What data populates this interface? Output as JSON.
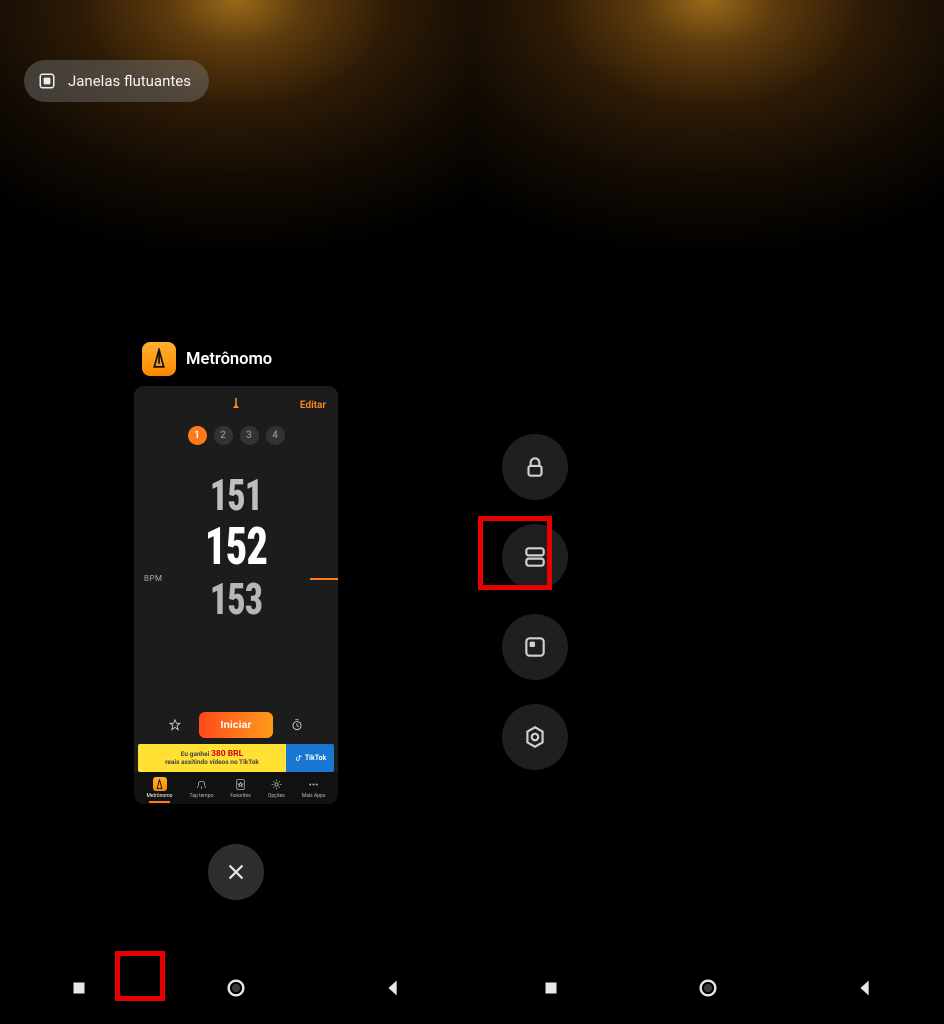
{
  "pill": {
    "label": "Janelas flutuantes"
  },
  "card": {
    "appName": "Metrônomo",
    "editLabel": "Editar",
    "bpmLabel": "BPM",
    "beats": [
      "1",
      "2",
      "3",
      "4"
    ],
    "activeBeat": 0,
    "numbers": {
      "top": "151",
      "mid": "152",
      "bot": "153"
    },
    "startLabel": "Iniciar",
    "ad": {
      "line1": "Eu ganhei",
      "amount": "380 BRL",
      "line2": "reais assitindo vídeos no TikTok",
      "brand": "TikTok"
    },
    "nav": {
      "items": [
        "Metrônomo",
        "Tap tempo",
        "Favoritos",
        "Opções",
        "Mais Apps"
      ]
    }
  },
  "rightActions": [
    "lock",
    "split",
    "window",
    "settings"
  ],
  "sysnav": [
    "recents",
    "home",
    "back"
  ]
}
